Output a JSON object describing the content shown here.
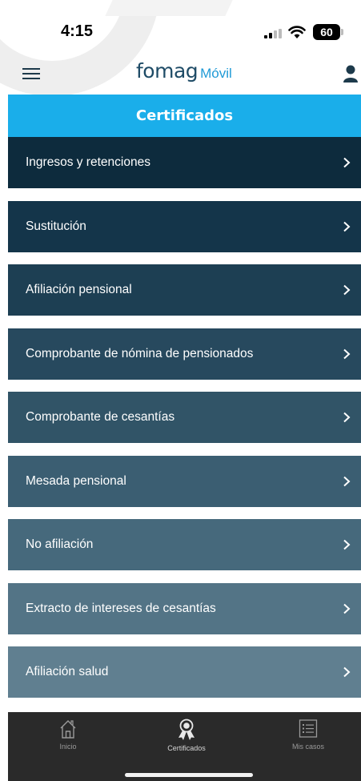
{
  "status_bar": {
    "time": "4:15",
    "battery": "60"
  },
  "header": {
    "logo_main": "fomag",
    "logo_sub": "Móvil"
  },
  "page": {
    "title": "Certificados"
  },
  "certificates": [
    {
      "label": "Ingresos y retenciones",
      "color": "#0d2b3d"
    },
    {
      "label": "Sustitución",
      "color": "#14354a"
    },
    {
      "label": "Afiliación pensional",
      "color": "#1d3f53"
    },
    {
      "label": "Comprobante de nómina de pensionados",
      "color": "#27495e"
    },
    {
      "label": "Comprobante de cesantías",
      "color": "#315467"
    },
    {
      "label": "Mesada pensional",
      "color": "#3b5e72"
    },
    {
      "label": "No afiliación",
      "color": "#46697c"
    },
    {
      "label": "Extracto de intereses de cesantías",
      "color": "#537486"
    },
    {
      "label": "Afiliación salud",
      "color": "#607f90"
    }
  ],
  "tab_bar": {
    "tabs": [
      {
        "label": "Inicio",
        "icon": "home-icon",
        "active": false
      },
      {
        "label": "Certificados",
        "icon": "certificate-icon",
        "active": true
      },
      {
        "label": "Mis casos",
        "icon": "list-icon",
        "active": false
      }
    ]
  }
}
